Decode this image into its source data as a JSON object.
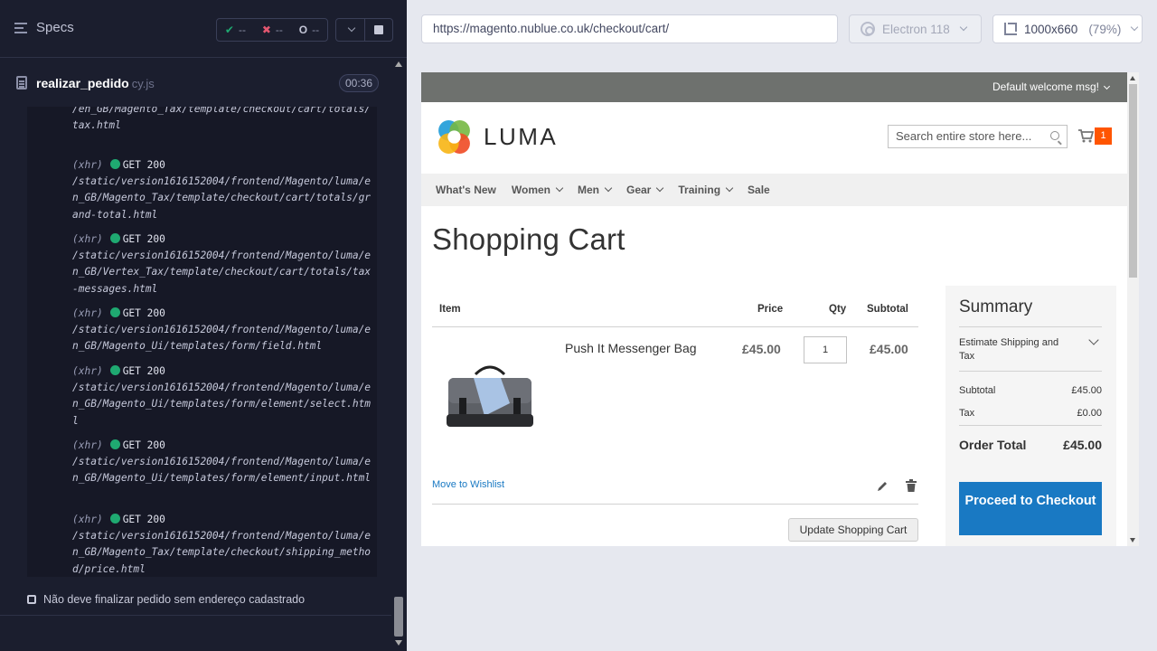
{
  "runner": {
    "specs_label": "Specs",
    "stats": {
      "passed": "--",
      "failed": "--",
      "pending": "--"
    },
    "spec_file": {
      "name": "realizar_pedido",
      "ext": "cy.js",
      "duration": "00:36"
    },
    "log_top_fragment": "/en_GB/Magento_Tax/template/checkout/cart/totals/tax.html",
    "log_entries": [
      {
        "type": "(xhr)",
        "method": "GET 200",
        "url": "/static/version1616152004/frontend/Magento/luma/en_GB/Magento_Tax/template/checkout/cart/totals/grand-total.html"
      },
      {
        "type": "(xhr)",
        "method": "GET 200",
        "url": "/static/version1616152004/frontend/Magento/luma/en_GB/Vertex_Tax/template/checkout/cart/totals/tax-messages.html"
      },
      {
        "type": "(xhr)",
        "method": "GET 200",
        "url": "/static/version1616152004/frontend/Magento/luma/en_GB/Magento_Ui/templates/form/field.html"
      },
      {
        "type": "(xhr)",
        "method": "GET 200",
        "url": "/static/version1616152004/frontend/Magento/luma/en_GB/Magento_Ui/templates/form/element/select.html"
      },
      {
        "type": "(xhr)",
        "method": "GET 200",
        "url": "/static/version1616152004/frontend/Magento/luma/en_GB/Magento_Ui/templates/form/element/input.html"
      },
      {
        "type": "(xhr)",
        "method": "GET 200",
        "url": "/static/version1616152004/frontend/Magento/luma/en_GB/Magento_Tax/template/checkout/shipping_method/price.html"
      }
    ],
    "pending_test": "Não deve finalizar pedido sem endereço cadastrado"
  },
  "aut_header": {
    "url": "https://magento.nublue.co.uk/checkout/cart/",
    "browser": "Electron 118",
    "viewport": "1000x660",
    "zoom": "(79%)"
  },
  "store": {
    "welcome_msg": "Default welcome msg!",
    "logo_text": "LUMA",
    "search_placeholder": "Search entire store here...",
    "cart_count": "1",
    "nav": [
      {
        "label": "What's New",
        "has_dropdown": false
      },
      {
        "label": "Women",
        "has_dropdown": true
      },
      {
        "label": "Men",
        "has_dropdown": true
      },
      {
        "label": "Gear",
        "has_dropdown": true
      },
      {
        "label": "Training",
        "has_dropdown": true
      },
      {
        "label": "Sale",
        "has_dropdown": false
      }
    ],
    "page_title": "Shopping Cart",
    "table_headers": {
      "item": "Item",
      "price": "Price",
      "qty": "Qty",
      "subtotal": "Subtotal"
    },
    "cart_item": {
      "name": "Push It Messenger Bag",
      "price": "£45.00",
      "qty": "1",
      "subtotal": "£45.00"
    },
    "move_to_wishlist": "Move to Wishlist",
    "update_cart": "Update Shopping Cart",
    "summary": {
      "title": "Summary",
      "estimate_shipping": "Estimate Shipping and Tax",
      "subtotal_label": "Subtotal",
      "subtotal_value": "£45.00",
      "tax_label": "Tax",
      "tax_value": "£0.00",
      "order_total_label": "Order Total",
      "order_total_value": "£45.00",
      "checkout_button": "Proceed to Checkout"
    }
  },
  "colors": {
    "runner_bg": "#1b1e2e",
    "success": "#1fa971",
    "fail": "#e45770",
    "luma_blue": "#1979c3",
    "luma_orange": "#ff5501"
  }
}
